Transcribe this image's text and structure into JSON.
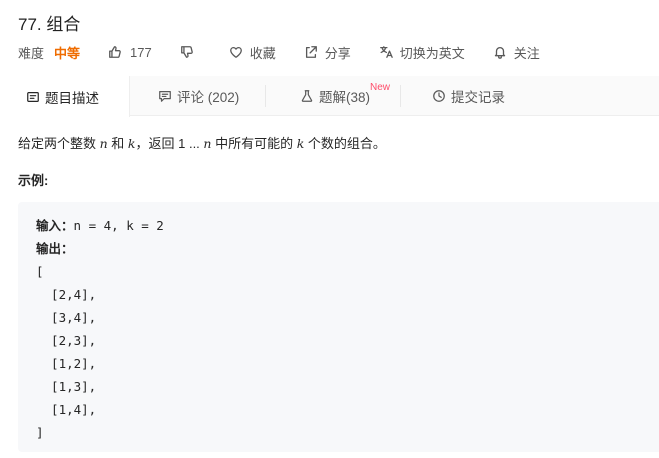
{
  "problem": {
    "title": "77. 组合",
    "difficulty_label": "难度",
    "difficulty": "中等",
    "likes": "177",
    "favorite_label": "收藏",
    "share_label": "分享",
    "translate_label": "切换为英文",
    "follow_label": "关注"
  },
  "tabs": {
    "description": "题目描述",
    "comments": "评论 (202)",
    "solutions": "题解(38)",
    "solutions_badge": "New",
    "submissions": "提交记录"
  },
  "description": {
    "p1": "给定两个整数 ",
    "n1": "n",
    "p2": " 和 ",
    "k1": "k",
    "p3": "，返回 1 ... ",
    "n2": "n",
    "p4": " 中所有可能的 ",
    "k2": "k",
    "p5": " 个数的组合。"
  },
  "example": {
    "heading": "示例:",
    "input_label": "输入：",
    "input_value": "n = 4, k = 2",
    "output_label": "输出：",
    "open_bracket": "[",
    "items": [
      "  [2,4],",
      "  [3,4],",
      "  [2,3],",
      "  [1,2],",
      "  [1,3],",
      "  [1,4],"
    ],
    "close_bracket": "]"
  },
  "colors": {
    "difficulty": "#ef6c00",
    "new_badge": "#ff4d6a",
    "code_bg": "#f7f8fa",
    "tab_bg": "#fafafa"
  }
}
